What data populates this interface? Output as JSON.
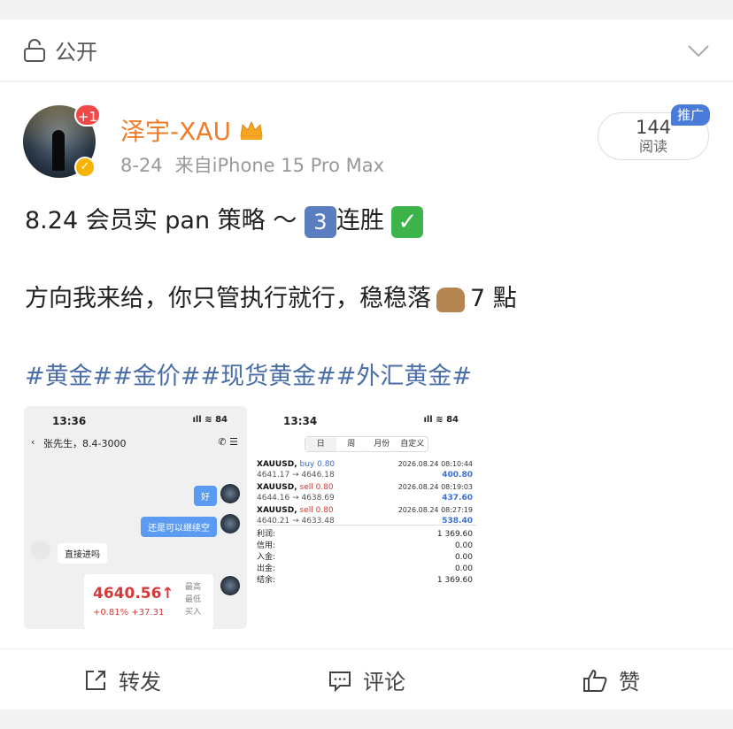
{
  "visibility": {
    "label": "公开"
  },
  "author": {
    "name": "泽宇-XAU",
    "unread_badge": "+1",
    "date": "8-24",
    "source": "来自iPhone 15 Pro Max"
  },
  "reads": {
    "count": "144",
    "label": "阅读",
    "promo": "推广"
  },
  "post": {
    "line1_prefix": "8.24 会员实 pan 策略 ～",
    "line1_box": "3",
    "line1_suffix": "连胜",
    "line2_prefix": "方向我来给，你只管执行就行，稳稳落",
    "line2_suffix": "7 點",
    "tags": "#黄金##金价##现货黄金##外汇黄金#"
  },
  "shot1": {
    "time": "13:36",
    "status_icons": "ıll ≋ 84",
    "chat_title": "张先生，8.4-3000",
    "msg_good": "好",
    "msg_continue": "还是可以继续空",
    "msg_direct": "直接进吗",
    "price": "4640.56↑",
    "change": "+0.81%  +37.31",
    "side_labels": [
      "最高",
      "最低",
      "买入"
    ]
  },
  "shot2": {
    "time": "13:34",
    "status_icons": "ıll ≋ 84",
    "tabs": [
      "日",
      "周",
      "月份",
      "自定义"
    ],
    "trades": [
      {
        "symbol": "XAUUSD,",
        "side": "buy 0.80",
        "prices": "4641.17 → 4646.18",
        "datetime": "2026.08.24 08:10:44",
        "profit": "400.80"
      },
      {
        "symbol": "XAUUSD,",
        "side": "sell 0.80",
        "prices": "4644.16 → 4638.69",
        "datetime": "2026.08.24 08:19:03",
        "profit": "437.60"
      },
      {
        "symbol": "XAUUSD,",
        "side": "sell 0.80",
        "prices": "4640.21 → 4633.48",
        "datetime": "2026.08.24 08:27:19",
        "profit": "538.40"
      }
    ],
    "summary": [
      {
        "label": "利润:",
        "value": "1 369.60"
      },
      {
        "label": "信用:",
        "value": "0.00"
      },
      {
        "label": "入金:",
        "value": "0.00"
      },
      {
        "label": "出金:",
        "value": "0.00"
      },
      {
        "label": "结余:",
        "value": "1 369.60"
      }
    ]
  },
  "actions": {
    "repost": "转发",
    "comment": "评论",
    "like": "赞"
  }
}
